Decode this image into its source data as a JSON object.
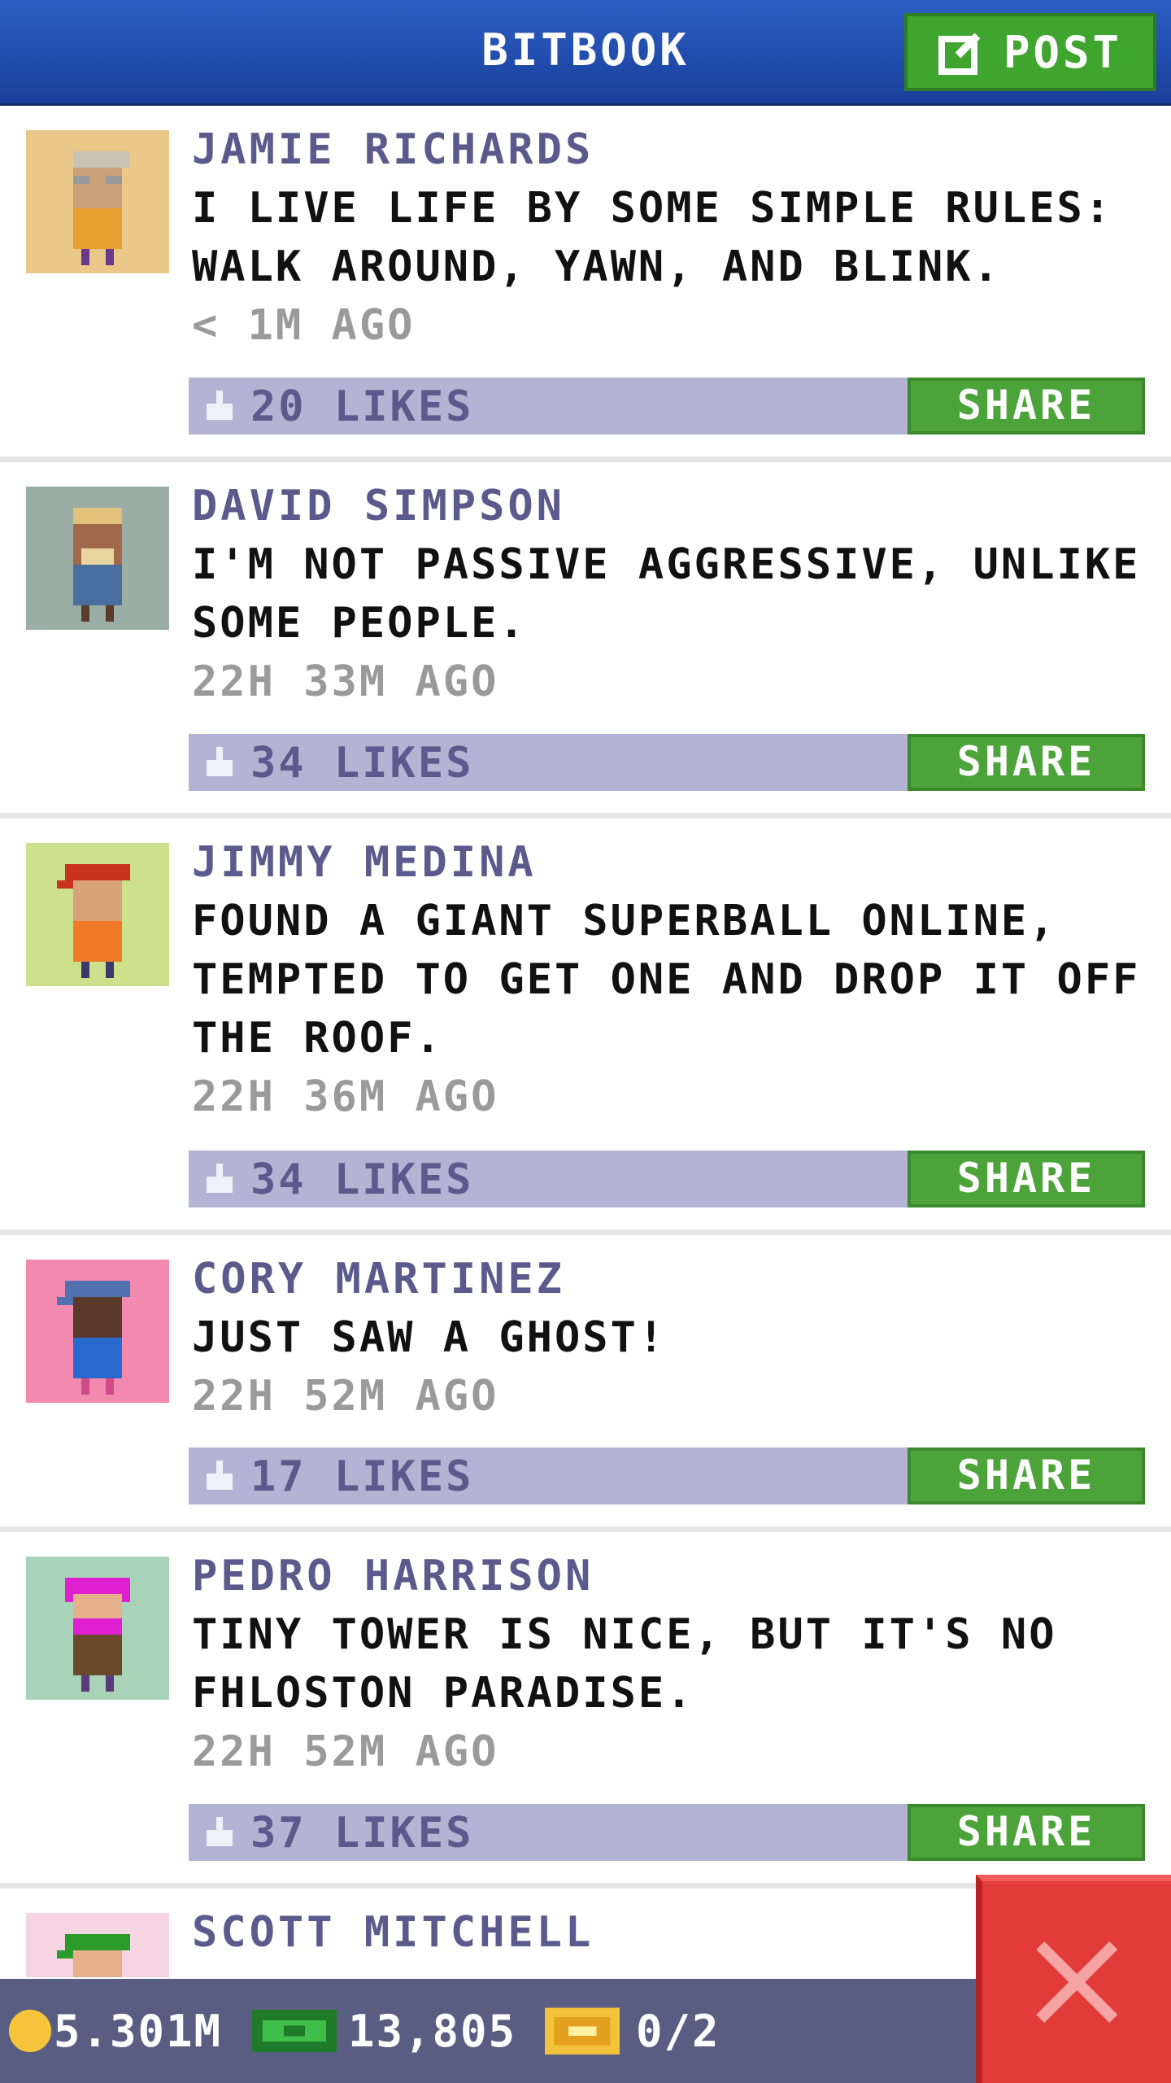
{
  "header": {
    "title": "BITBOOK",
    "post_label": "POST"
  },
  "posts": [
    {
      "name": "JAMIE RICHARDS",
      "text": "I LIVE LIFE BY SOME SIMPLE RULES: WALK AROUND, YAWN, AND BLINK.",
      "time": "< 1M AGO",
      "likes": "20 LIKES",
      "share_label": "SHARE",
      "avatar_bg": "#e9c88a"
    },
    {
      "name": "DAVID SIMPSON",
      "text": "I'M NOT PASSIVE AGGRESSIVE, UNLIKE SOME PEOPLE.",
      "time": "22H 33M AGO",
      "likes": "34 LIKES",
      "share_label": "SHARE",
      "avatar_bg": "#9aaea6"
    },
    {
      "name": "JIMMY MEDINA",
      "text": "FOUND A GIANT SUPERBALL ONLINE, TEMPTED TO GET ONE AND DROP IT OFF THE ROOF.",
      "time": "22H 36M AGO",
      "likes": "34 LIKES",
      "share_label": "SHARE",
      "avatar_bg": "#cde08c"
    },
    {
      "name": "CORY MARTINEZ",
      "text": "JUST SAW A GHOST!",
      "time": "22H 52M AGO",
      "likes": "17 LIKES",
      "share_label": "SHARE",
      "avatar_bg": "#f28aaf"
    },
    {
      "name": "PEDRO HARRISON",
      "text": "TINY TOWER IS NICE, BUT IT'S NO FHLOSTON PARADISE.",
      "time": "22H 52M AGO",
      "likes": "37 LIKES",
      "share_label": "SHARE",
      "avatar_bg": "#a8d3b8"
    },
    {
      "name": "SCOTT MITCHELL",
      "text": "",
      "time": "",
      "likes": "",
      "share_label": "",
      "avatar_bg": "#f6d5e3"
    }
  ],
  "bottom_bar": {
    "coins": "5.301M",
    "bux": "13,805",
    "tickets": "0/2"
  },
  "colors": {
    "header": "#1f4aa8",
    "post_button": "#3fa52f",
    "like_bar": "#b3b3d4",
    "share_button": "#4ba33a",
    "bottom_bar": "#5a5d82",
    "close_button": "#e33a3a"
  },
  "icons": {
    "post": "compose-icon",
    "like": "thumbs-up-icon",
    "coin": "coin-icon",
    "bux": "bux-icon",
    "ticket": "ticket-icon",
    "close": "close-icon"
  }
}
